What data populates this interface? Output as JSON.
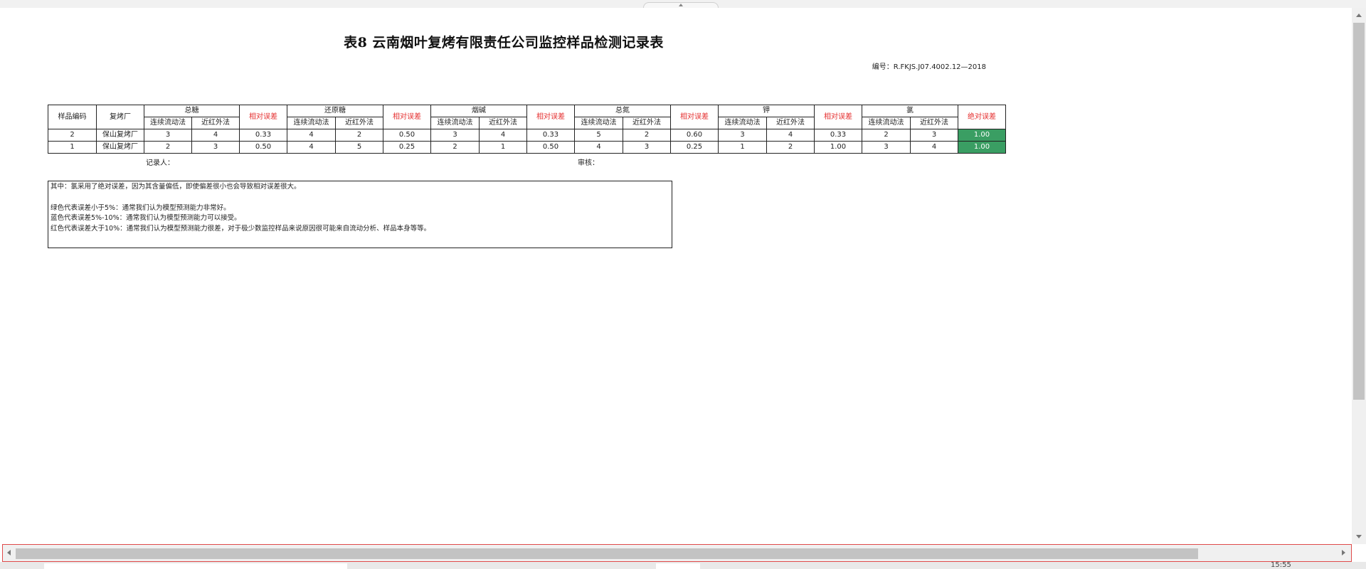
{
  "document": {
    "title": "表8 云南烟叶复烤有限责任公司监控样品检测记录表",
    "doc_number": "编号：R.FKJS.J07.4002.12—2018"
  },
  "table": {
    "header": {
      "sample_code": "样品编码",
      "factory": "复烤厂",
      "total_sugar": "总糖",
      "reducing_sugar": "还原糖",
      "nicotine": "烟碱",
      "total_nitrogen": "总氮",
      "potassium": "钾",
      "chlorine": "氯",
      "relative_error": "相对误差",
      "absolute_error": "绝对误差",
      "method_cfa": "连续流动法",
      "method_nir": "近红外法"
    },
    "rows": [
      {
        "code": "2",
        "factory": "保山复烤厂",
        "ts_cfa": "3",
        "ts_nir": "4",
        "ts_err": "0.33",
        "rs_cfa": "4",
        "rs_nir": "2",
        "rs_err": "0.50",
        "nic_cfa": "3",
        "nic_nir": "4",
        "nic_err": "0.33",
        "tn_cfa": "5",
        "tn_nir": "2",
        "tn_err": "0.60",
        "k_cfa": "3",
        "k_nir": "4",
        "k_err": "0.33",
        "cl_cfa": "2",
        "cl_nir": "3",
        "cl_err": "1.00"
      },
      {
        "code": "1",
        "factory": "保山复烤厂",
        "ts_cfa": "2",
        "ts_nir": "3",
        "ts_err": "0.50",
        "rs_cfa": "4",
        "rs_nir": "5",
        "rs_err": "0.25",
        "nic_cfa": "2",
        "nic_nir": "1",
        "nic_err": "0.50",
        "tn_cfa": "4",
        "tn_nir": "3",
        "tn_err": "0.25",
        "k_cfa": "1",
        "k_nir": "2",
        "k_err": "1.00",
        "cl_cfa": "3",
        "cl_nir": "4",
        "cl_err": "1.00"
      }
    ]
  },
  "signatures": {
    "recorder": "记录人：",
    "reviewer": "审核："
  },
  "notes": [
    "其中：氯采用了绝对误差，因为其含量偏低，即使偏差很小也会导致相对误差很大。",
    "绿色代表误差小于5%：通常我们认为模型预测能力非常好。",
    "蓝色代表误差5%-10%：通常我们认为模型预测能力可以接受。",
    "红色代表误差大于10%：通常我们认为模型预测能力很差，对于极少数监控样品来说原因很可能来自流动分析、样品本身等等。"
  ],
  "status": {
    "clock": "15:55"
  },
  "colors": {
    "error_header": "#e53030",
    "good_fill": "#3a9e63"
  }
}
